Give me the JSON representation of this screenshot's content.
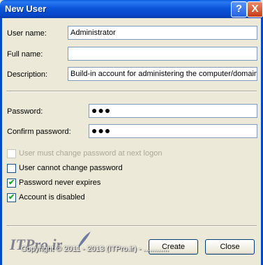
{
  "window": {
    "title": "New User",
    "help_glyph": "?",
    "close_glyph": "X"
  },
  "fields": {
    "username_label": "User name:",
    "username_value": "Administrator",
    "fullname_label": "Full name:",
    "fullname_value": "",
    "description_label": "Description:",
    "description_value": "Build-in account for administering the computer/domain",
    "password_label": "Password:",
    "password_value": "●●●",
    "confirm_label": "Confirm password:",
    "confirm_value": "●●●"
  },
  "options": [
    {
      "label": "User must change password at next logon",
      "checked": false,
      "disabled": true
    },
    {
      "label": "User cannot change password",
      "checked": false,
      "disabled": false
    },
    {
      "label": "Password never expires",
      "checked": true,
      "disabled": false
    },
    {
      "label": "Account is disabled",
      "checked": true,
      "disabled": false
    }
  ],
  "buttons": {
    "create": "Create",
    "close": "Close"
  },
  "watermark": {
    "logo": "ITPro.ir",
    "copyright": "Copyright © 2011 - 2013 (ITPro.ir) - ............"
  },
  "colors": {
    "titlebar": "#0846c8",
    "dialog_bg": "#ece9d8",
    "check": "#21a121"
  }
}
